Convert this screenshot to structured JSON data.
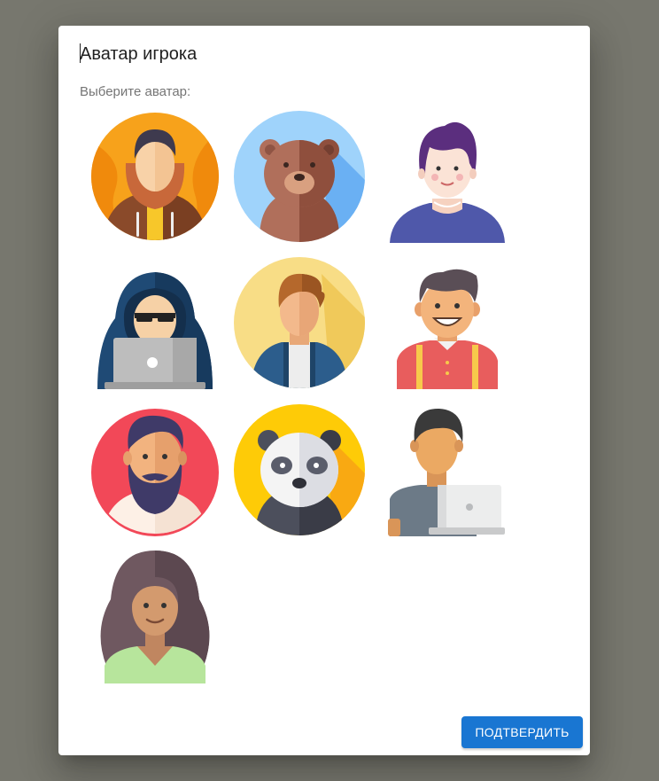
{
  "dialog": {
    "title": "Аватар игрока",
    "subtitle": "Выберите аватар:",
    "confirm_label": "ПОДТВЕРДИТЬ"
  },
  "avatars": [
    {
      "icon": "man-hoodie-avatar-icon"
    },
    {
      "icon": "bear-avatar-icon"
    },
    {
      "icon": "purple-hair-person-avatar-icon"
    },
    {
      "icon": "hacker-laptop-avatar-icon"
    },
    {
      "icon": "young-man-jacket-avatar-icon"
    },
    {
      "icon": "smiling-man-suspenders-avatar-icon"
    },
    {
      "icon": "bearded-man-avatar-icon"
    },
    {
      "icon": "panda-avatar-icon"
    },
    {
      "icon": "man-laptop-avatar-icon"
    },
    {
      "icon": "long-hair-woman-avatar-icon"
    }
  ],
  "colors": {
    "backdrop": "#77776e",
    "dialog_bg": "#ffffff",
    "button_bg": "#1976d2"
  }
}
